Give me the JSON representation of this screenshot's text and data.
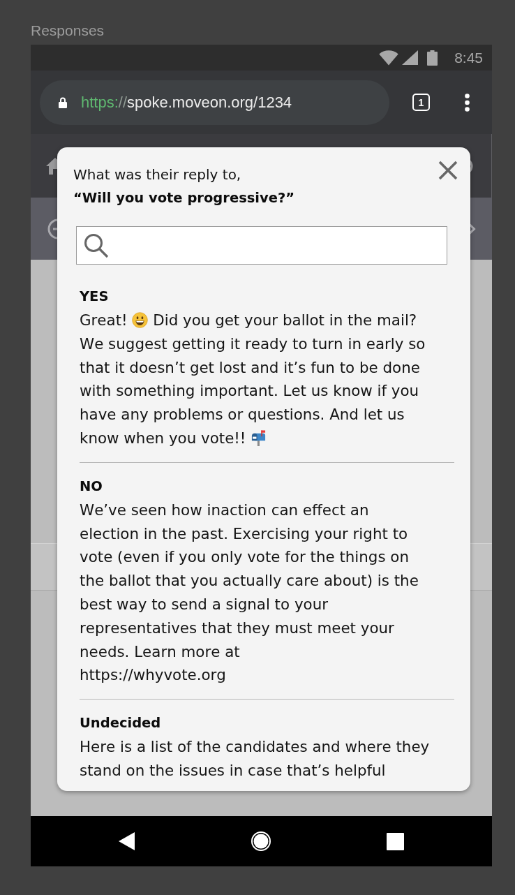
{
  "page_title": "Responses",
  "status_bar": {
    "time": "8:45"
  },
  "browser": {
    "url": {
      "scheme": "https:",
      "separator": "//",
      "rest": "spoke.moveon.org/1234"
    },
    "tab_count": "1"
  },
  "dialog": {
    "prompt": "What was their reply to,",
    "question": "“Will you vote progressive?”",
    "responses": [
      {
        "title": "YES",
        "body": [
          {
            "kind": "text",
            "text": "Great!"
          },
          {
            "kind": "smiley"
          },
          {
            "kind": "text",
            "text": "Did you get your ballot in the mail? We suggest getting it ready to turn in early so that it doesn’t get lost and it’s fun to be done with something important. Let us know if you have any problems or questions. And let us know when you vote!!"
          },
          {
            "kind": "mailbox"
          }
        ]
      },
      {
        "title": "NO",
        "body": [
          {
            "kind": "text",
            "text": "We’ve seen how inaction can effect an election in the past. Exercising your right to vote (even if you only vote for the things on the ballot that you actually care about) is the best way to send a signal to your representatives that they must meet your needs. Learn more at\nhttps://whyvote.org"
          }
        ]
      },
      {
        "title": "Undecided",
        "body": [
          {
            "kind": "text",
            "text": "Here is a list of the candidates and where they stand on the issues in case that’s helpful"
          }
        ]
      }
    ]
  }
}
